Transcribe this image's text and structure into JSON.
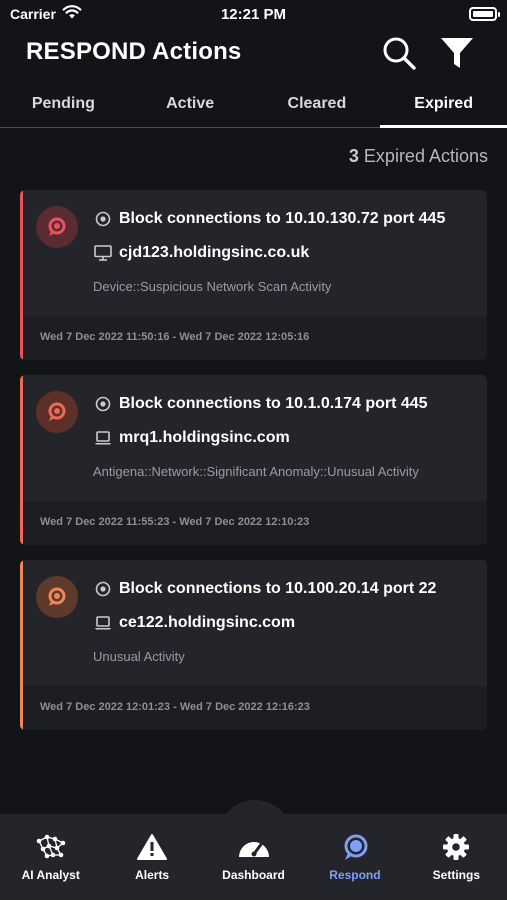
{
  "status_bar": {
    "carrier": "Carrier",
    "time": "12:21 PM"
  },
  "header": {
    "title": "RESPOND Actions"
  },
  "tabs": [
    {
      "label": "Pending"
    },
    {
      "label": "Active"
    },
    {
      "label": "Cleared"
    },
    {
      "label": "Expired",
      "active": true
    }
  ],
  "summary": {
    "count": "3",
    "text": "Expired Actions"
  },
  "cards": [
    {
      "action": "Block connections to 10.10.130.72 port 445",
      "device": "cjd123.holdingsinc.co.uk",
      "device_icon": "desktop-icon",
      "model": "Device::Suspicious Network Scan Activity",
      "time_range": "Wed 7 Dec 2022 11:50:16  - Wed 7 Dec 2022 12:05:16",
      "color": "#e8545c"
    },
    {
      "action": "Block connections to 10.1.0.174 port 445",
      "device": "mrq1.holdingsinc.com",
      "device_icon": "laptop-icon",
      "model": "Antigena::Network::Significant Anomaly::Unusual Activity",
      "time_range": "Wed 7 Dec 2022 11:55:23  - Wed 7 Dec 2022 12:10:23",
      "color": "#ee6a58"
    },
    {
      "action": "Block connections to 10.100.20.14 port 22",
      "device": "ce122.holdingsinc.com",
      "device_icon": "laptop-icon",
      "model": "Unusual Activity",
      "time_range": "Wed 7 Dec 2022 12:01:23  - Wed 7 Dec 2022 12:16:23",
      "color": "#f1855c"
    }
  ],
  "bottom_nav": [
    {
      "label": "AI Analyst",
      "icon": "ai-analyst-icon"
    },
    {
      "label": "Alerts",
      "icon": "alert-triangle-icon"
    },
    {
      "label": "Dashboard",
      "icon": "gauge-icon"
    },
    {
      "label": "Respond",
      "icon": "respond-icon",
      "active": true
    },
    {
      "label": "Settings",
      "icon": "gear-icon"
    }
  ],
  "colors": {
    "background": "#121418",
    "card": "#23252b",
    "active_nav": "#7f9ff4"
  }
}
